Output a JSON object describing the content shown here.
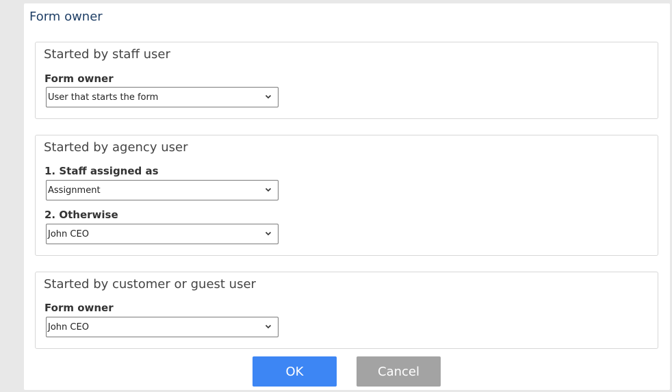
{
  "dialog": {
    "title": "Form owner",
    "sections": [
      {
        "title": "Started by staff user",
        "fields": [
          {
            "label": "Form owner",
            "value": "User that starts the form"
          }
        ]
      },
      {
        "title": "Started by agency user",
        "fields": [
          {
            "label": "1. Staff assigned as",
            "value": "Assignment"
          },
          {
            "label": "2. Otherwise",
            "value": "John CEO"
          }
        ]
      },
      {
        "title": "Started by customer or guest user",
        "fields": [
          {
            "label": "Form owner",
            "value": "John CEO"
          }
        ]
      }
    ],
    "buttons": {
      "ok": "OK",
      "cancel": "Cancel"
    }
  },
  "colors": {
    "primary_button": "#3d86f4",
    "secondary_button": "#a3a3a3",
    "title_text": "#1f3f66"
  }
}
